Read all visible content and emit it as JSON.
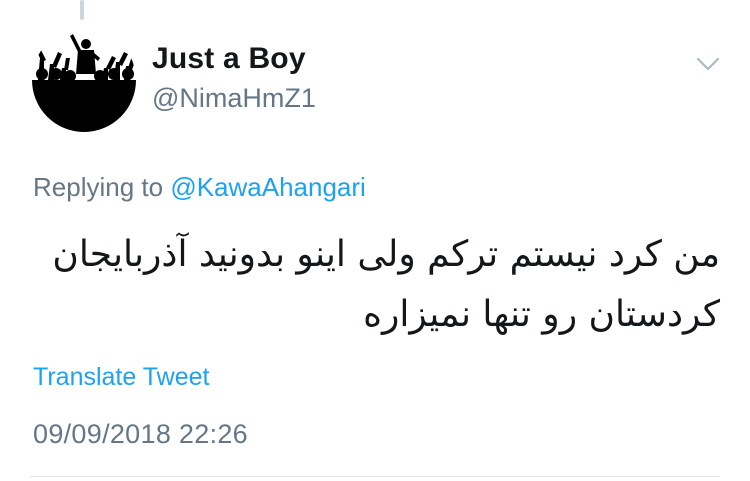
{
  "user": {
    "display_name": "Just a Boy",
    "handle": "@NimaHmZ1"
  },
  "reply": {
    "prefix": "Replying to",
    "mention": "@KawaAhangari"
  },
  "tweet": {
    "lines": [
      "من کرد نیستم ترکم ولی اینو بدونید آذربایجان",
      "کردستان رو تنها نمیزاره"
    ]
  },
  "actions": {
    "translate_label": "Translate Tweet"
  },
  "meta": {
    "timestamp": "09/09/2018 22:26"
  },
  "icons": {
    "menu": "chevron-down-icon",
    "avatar": "avatar-silhouette"
  },
  "colors": {
    "link": "#1da1f2",
    "secondary_text": "#657786",
    "primary_text": "#14171a",
    "divider": "#e1e8ed"
  }
}
